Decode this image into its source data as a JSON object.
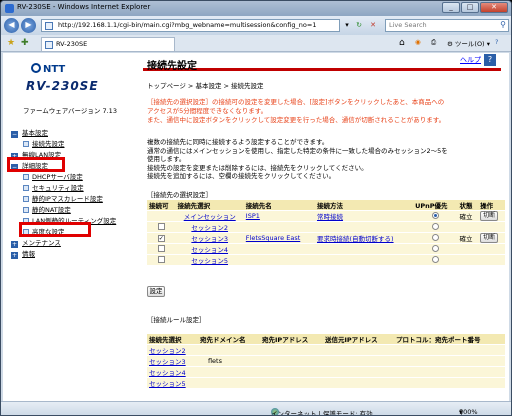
{
  "window": {
    "title": "RV-230SE - Windows Internet Explorer"
  },
  "browser": {
    "url": "http://192.168.1.1/cgi-bin/main.cgi?mbg_webname=multisession&config_no=1",
    "search_placeholder": "Live Search",
    "tab_title": "RV-230SE",
    "home_glyph": "⌂",
    "tools_label": "ツール(O)",
    "dropdown_glyph": "▾"
  },
  "sidebar": {
    "brand": "NTT",
    "model": "RV-230SE",
    "firmware": "ファームウェアバージョン 7.13",
    "items": [
      {
        "label": "基本設定",
        "icon": "minus"
      },
      {
        "label": "接続先設定",
        "sub": true
      },
      {
        "label": "無線LAN設定",
        "icon": "plus"
      },
      {
        "label": "詳細設定",
        "icon": "minus"
      },
      {
        "label": "DHCPサーバ設定",
        "sub": true
      },
      {
        "label": "セキュリティ設定",
        "sub": true
      },
      {
        "label": "静的IPマスカレード設定",
        "sub": true
      },
      {
        "label": "静的NAT設定",
        "sub": true
      },
      {
        "label": "LAN側静的ルーティング設定",
        "sub": true
      },
      {
        "label": "高度な設定",
        "sub": true
      },
      {
        "label": "メンテナンス",
        "icon": "plus"
      },
      {
        "label": "情報",
        "icon": "plus"
      }
    ]
  },
  "main": {
    "title": "接続先設定",
    "help": "ヘルプ",
    "help_icon": "?",
    "breadcrumb": "トップページ > 基本設定 > 接続先設定",
    "warning_lines": [
      "［接続先の選択設定］の接続可の設定を変更した場合、[設定]ボタンをクリックしたあと、本商品への",
      "アクセスが5分間程度できなくなります。",
      "また、通信中に設定ボタンをクリックして設定変更を行った場合、通信が切断されることがあります。"
    ],
    "note_lines": [
      "複数の接続先に同時に接続するよう設定することができます。",
      "通常の通信にはメインセッションを使用し、指定した特定の条件に一致した場合のみセッション2～5を",
      "使用します。",
      "接続先の設定を変更または削除するには、接続先をクリックしてください。",
      "接続先を追加するには、空欄の接続先をクリックしてください。"
    ],
    "select_section": "［接続先の選択設定］",
    "select_headers": [
      "接続可",
      "接続先選択",
      "接続先名",
      "接続方法",
      "UPnP優先",
      "状態",
      "操作"
    ],
    "select_rows": [
      {
        "enabled": "",
        "session": "メインセッション",
        "name": "ISP1",
        "method": "常時接続",
        "upnp": true,
        "status": "確立",
        "op": "切断"
      },
      {
        "enabled": "",
        "session": "セッション2",
        "name": "",
        "method": "",
        "upnp": false,
        "status": "",
        "op": ""
      },
      {
        "enabled": "✓",
        "session": "セッション3",
        "name": "FletsSquare East",
        "method": "要求時接続(自動切断する)",
        "upnp": false,
        "status": "確立",
        "op": "切断"
      },
      {
        "enabled": "",
        "session": "セッション4",
        "name": "",
        "method": "",
        "upnp": false,
        "status": "",
        "op": ""
      },
      {
        "enabled": "",
        "session": "セッション5",
        "name": "",
        "method": "",
        "upnp": false,
        "status": "",
        "op": ""
      }
    ],
    "set_button": "設定",
    "rule_section": "［接続ルール設定］",
    "rule_headers": [
      "接続先選択",
      "宛先ドメイン名",
      "宛先IPアドレス",
      "送信元IPアドレス",
      "プロトコル：宛先ポート番号"
    ],
    "rule_rows": [
      {
        "session": "セッション2",
        "domain": ""
      },
      {
        "session": "セッション3",
        "domain": "flets"
      },
      {
        "session": "セッション4",
        "domain": ""
      },
      {
        "session": "セッション5",
        "domain": ""
      }
    ]
  },
  "statusbar": {
    "zone": "インターネット | 保護モード: 有効",
    "zoom": "100%"
  },
  "colors": {
    "accent": "#c00000",
    "warning": "#e8431a",
    "table_header": "#f3e9b2",
    "highlight": "#e00000"
  }
}
